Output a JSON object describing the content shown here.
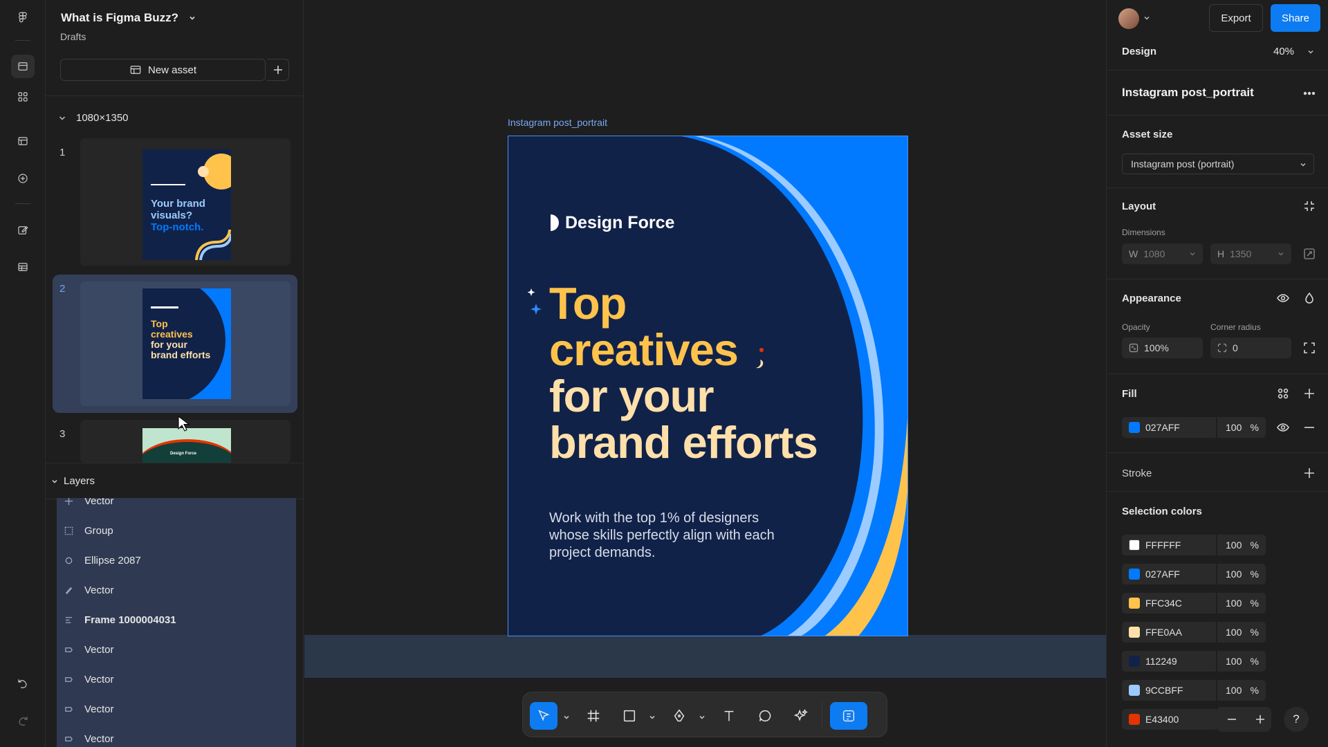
{
  "file": {
    "title": "What is Figma Buzz?",
    "location": "Drafts",
    "new_asset_label": "New asset"
  },
  "assets": {
    "size_group": "1080×1350",
    "thumbnails": [
      {
        "number": "1",
        "text_line1": "Your brand",
        "text_line2": "visuals?",
        "text_line3": "Top-notch."
      },
      {
        "number": "2",
        "text_line1": "Top",
        "text_line2": "creatives",
        "text_line3": "for your",
        "text_line4": "brand efforts"
      },
      {
        "number": "3",
        "brand": "Design Force"
      }
    ]
  },
  "layers": {
    "heading": "Layers",
    "items": [
      {
        "name": "Vector"
      },
      {
        "name": "Group"
      },
      {
        "name": "Ellipse 2087"
      },
      {
        "name": "Vector"
      },
      {
        "name": "Frame 1000004031"
      },
      {
        "name": "Vector"
      },
      {
        "name": "Vector"
      },
      {
        "name": "Vector"
      },
      {
        "name": "Vector"
      }
    ]
  },
  "canvas": {
    "frame_label": "Instagram post_portrait",
    "brand": "Design Force",
    "headline": [
      "Top",
      "creatives",
      "for your",
      "brand efforts"
    ],
    "body": "Work with the top 1% of designers whose skills perfectly align with each project demands."
  },
  "header": {
    "export_label": "Export",
    "share_label": "Share"
  },
  "design_panel": {
    "tab": "Design",
    "zoom": "40%",
    "selection_name": "Instagram post_portrait",
    "asset_size": {
      "label": "Asset size",
      "value": "Instagram post (portrait)"
    },
    "layout": {
      "label": "Layout",
      "dimensions_label": "Dimensions",
      "w_label": "W",
      "w_value": "1080",
      "h_label": "H",
      "h_value": "1350"
    },
    "appearance": {
      "label": "Appearance",
      "opacity_label": "Opacity",
      "opacity_value": "100%",
      "corner_radius_label": "Corner radius",
      "corner_radius_value": "0"
    },
    "fill": {
      "label": "Fill",
      "hex": "027AFF",
      "opacity": "100",
      "unit": "%"
    },
    "stroke": {
      "label": "Stroke"
    },
    "selection_colors": {
      "label": "Selection colors",
      "items": [
        {
          "hex": "FFFFFF",
          "color": "#FFFFFF",
          "opacity": "100",
          "unit": "%"
        },
        {
          "hex": "027AFF",
          "color": "#027AFF",
          "opacity": "100",
          "unit": "%"
        },
        {
          "hex": "FFC34C",
          "color": "#FFC34C",
          "opacity": "100",
          "unit": "%"
        },
        {
          "hex": "FFE0AA",
          "color": "#FFE0AA",
          "opacity": "100",
          "unit": "%"
        },
        {
          "hex": "112249",
          "color": "#112249",
          "opacity": "100",
          "unit": "%"
        },
        {
          "hex": "9CCBFF",
          "color": "#9CCBFF",
          "opacity": "100",
          "unit": "%"
        },
        {
          "hex": "E43400",
          "color": "#E43400",
          "opacity": "100",
          "unit": "%"
        }
      ]
    }
  },
  "help": {
    "label": "?"
  },
  "colors": {
    "accent": "#0D7CF2",
    "frame_bg": "#027AFF",
    "navy": "#112249",
    "yellow": "#FFC34C",
    "cream": "#FFE0AA",
    "light_blue": "#9CCBFF",
    "red": "#E43400"
  }
}
